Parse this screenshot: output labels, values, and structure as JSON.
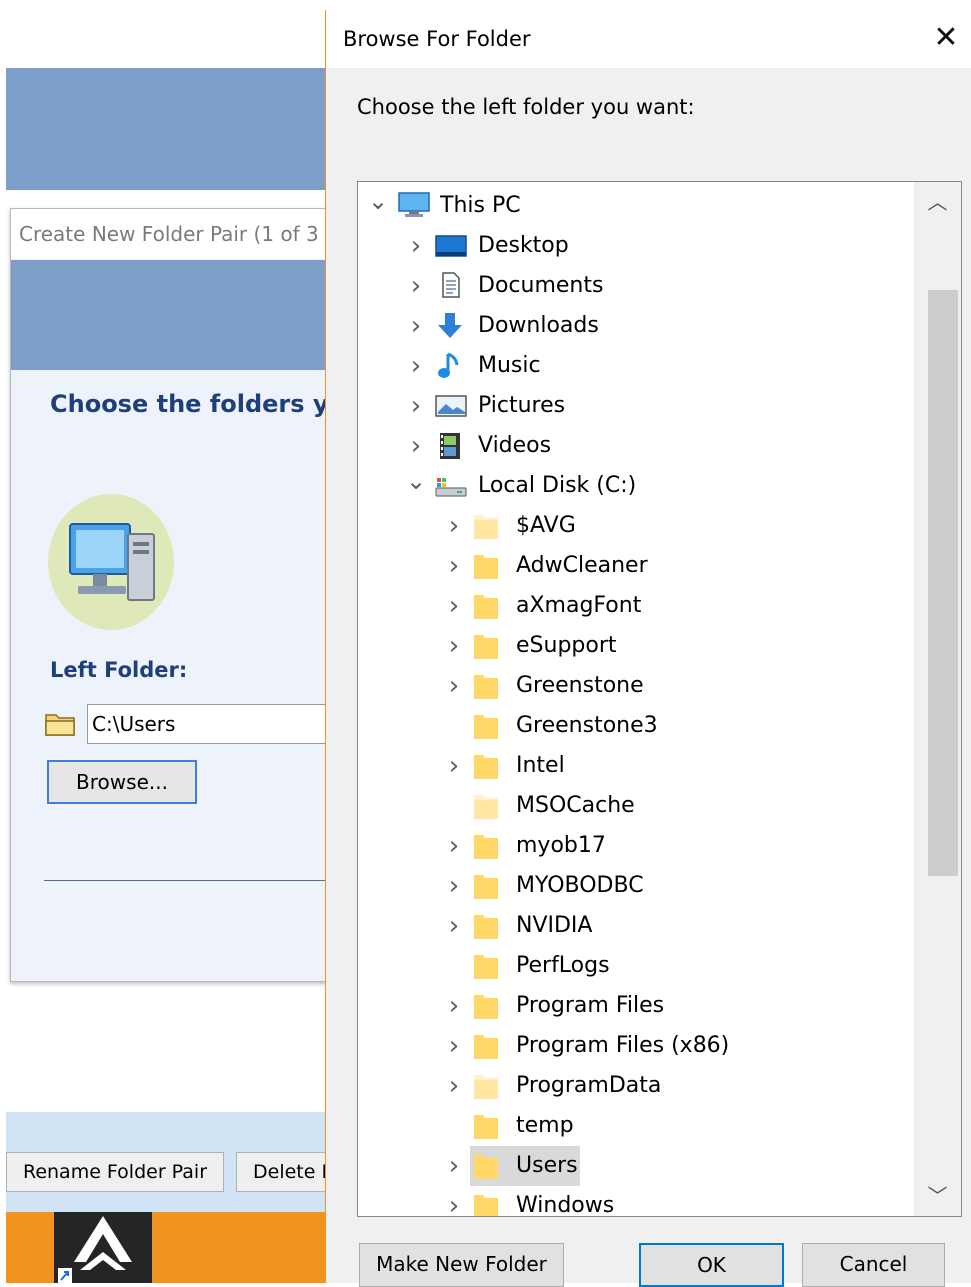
{
  "background_app": {
    "window_title": "Create New Folder Pair (1 of 3",
    "heading": "Choose the folders yo",
    "left_folder_label": "Left Folder:",
    "left_folder_value": "C:\\Users",
    "browse_label": "Browse...",
    "rename_label": "Rename Folder Pair",
    "delete_label": "Delete F"
  },
  "dialog": {
    "title": "Browse For Folder",
    "close_glyph": "✕",
    "prompt": "Choose the left folder you want:",
    "buttons": {
      "make_new_folder": "Make New Folder",
      "ok": "OK",
      "cancel": "Cancel"
    },
    "colors": {
      "accent": "#0078d7",
      "folder": "#ffd867",
      "selection": "#d9d9d9"
    },
    "tree": [
      {
        "label": "This PC",
        "level": 0,
        "expanded": true,
        "has_children": true,
        "icon": "this-pc-icon"
      },
      {
        "label": "Desktop",
        "level": 1,
        "expanded": false,
        "has_children": true,
        "icon": "desktop-icon"
      },
      {
        "label": "Documents",
        "level": 1,
        "expanded": false,
        "has_children": true,
        "icon": "documents-icon"
      },
      {
        "label": "Downloads",
        "level": 1,
        "expanded": false,
        "has_children": true,
        "icon": "downloads-icon"
      },
      {
        "label": "Music",
        "level": 1,
        "expanded": false,
        "has_children": true,
        "icon": "music-icon"
      },
      {
        "label": "Pictures",
        "level": 1,
        "expanded": false,
        "has_children": true,
        "icon": "pictures-icon"
      },
      {
        "label": "Videos",
        "level": 1,
        "expanded": false,
        "has_children": true,
        "icon": "videos-icon"
      },
      {
        "label": "Local Disk (C:)",
        "level": 1,
        "expanded": true,
        "has_children": true,
        "icon": "local-disk-icon"
      },
      {
        "label": "$AVG",
        "level": 2,
        "has_children": true,
        "icon": "folder-icon",
        "faded": true
      },
      {
        "label": "AdwCleaner",
        "level": 2,
        "has_children": true,
        "icon": "folder-icon"
      },
      {
        "label": "aXmagFont",
        "level": 2,
        "has_children": true,
        "icon": "folder-icon"
      },
      {
        "label": "eSupport",
        "level": 2,
        "has_children": true,
        "icon": "folder-icon"
      },
      {
        "label": "Greenstone",
        "level": 2,
        "has_children": true,
        "icon": "folder-icon"
      },
      {
        "label": "Greenstone3",
        "level": 2,
        "has_children": false,
        "icon": "folder-icon"
      },
      {
        "label": "Intel",
        "level": 2,
        "has_children": true,
        "icon": "folder-icon"
      },
      {
        "label": "MSOCache",
        "level": 2,
        "has_children": false,
        "icon": "folder-icon",
        "faded": true
      },
      {
        "label": "myob17",
        "level": 2,
        "has_children": true,
        "icon": "folder-icon"
      },
      {
        "label": "MYOBODBC",
        "level": 2,
        "has_children": true,
        "icon": "folder-icon"
      },
      {
        "label": "NVIDIA",
        "level": 2,
        "has_children": true,
        "icon": "folder-icon"
      },
      {
        "label": "PerfLogs",
        "level": 2,
        "has_children": false,
        "icon": "folder-icon"
      },
      {
        "label": "Program Files",
        "level": 2,
        "has_children": true,
        "icon": "folder-icon"
      },
      {
        "label": "Program Files (x86)",
        "level": 2,
        "has_children": true,
        "icon": "folder-icon"
      },
      {
        "label": "ProgramData",
        "level": 2,
        "has_children": true,
        "icon": "folder-icon",
        "faded": true
      },
      {
        "label": "temp",
        "level": 2,
        "has_children": false,
        "icon": "folder-icon"
      },
      {
        "label": "Users",
        "level": 2,
        "has_children": true,
        "icon": "folder-icon",
        "selected": true
      },
      {
        "label": "Windows",
        "level": 2,
        "has_children": true,
        "icon": "folder-icon"
      }
    ]
  }
}
